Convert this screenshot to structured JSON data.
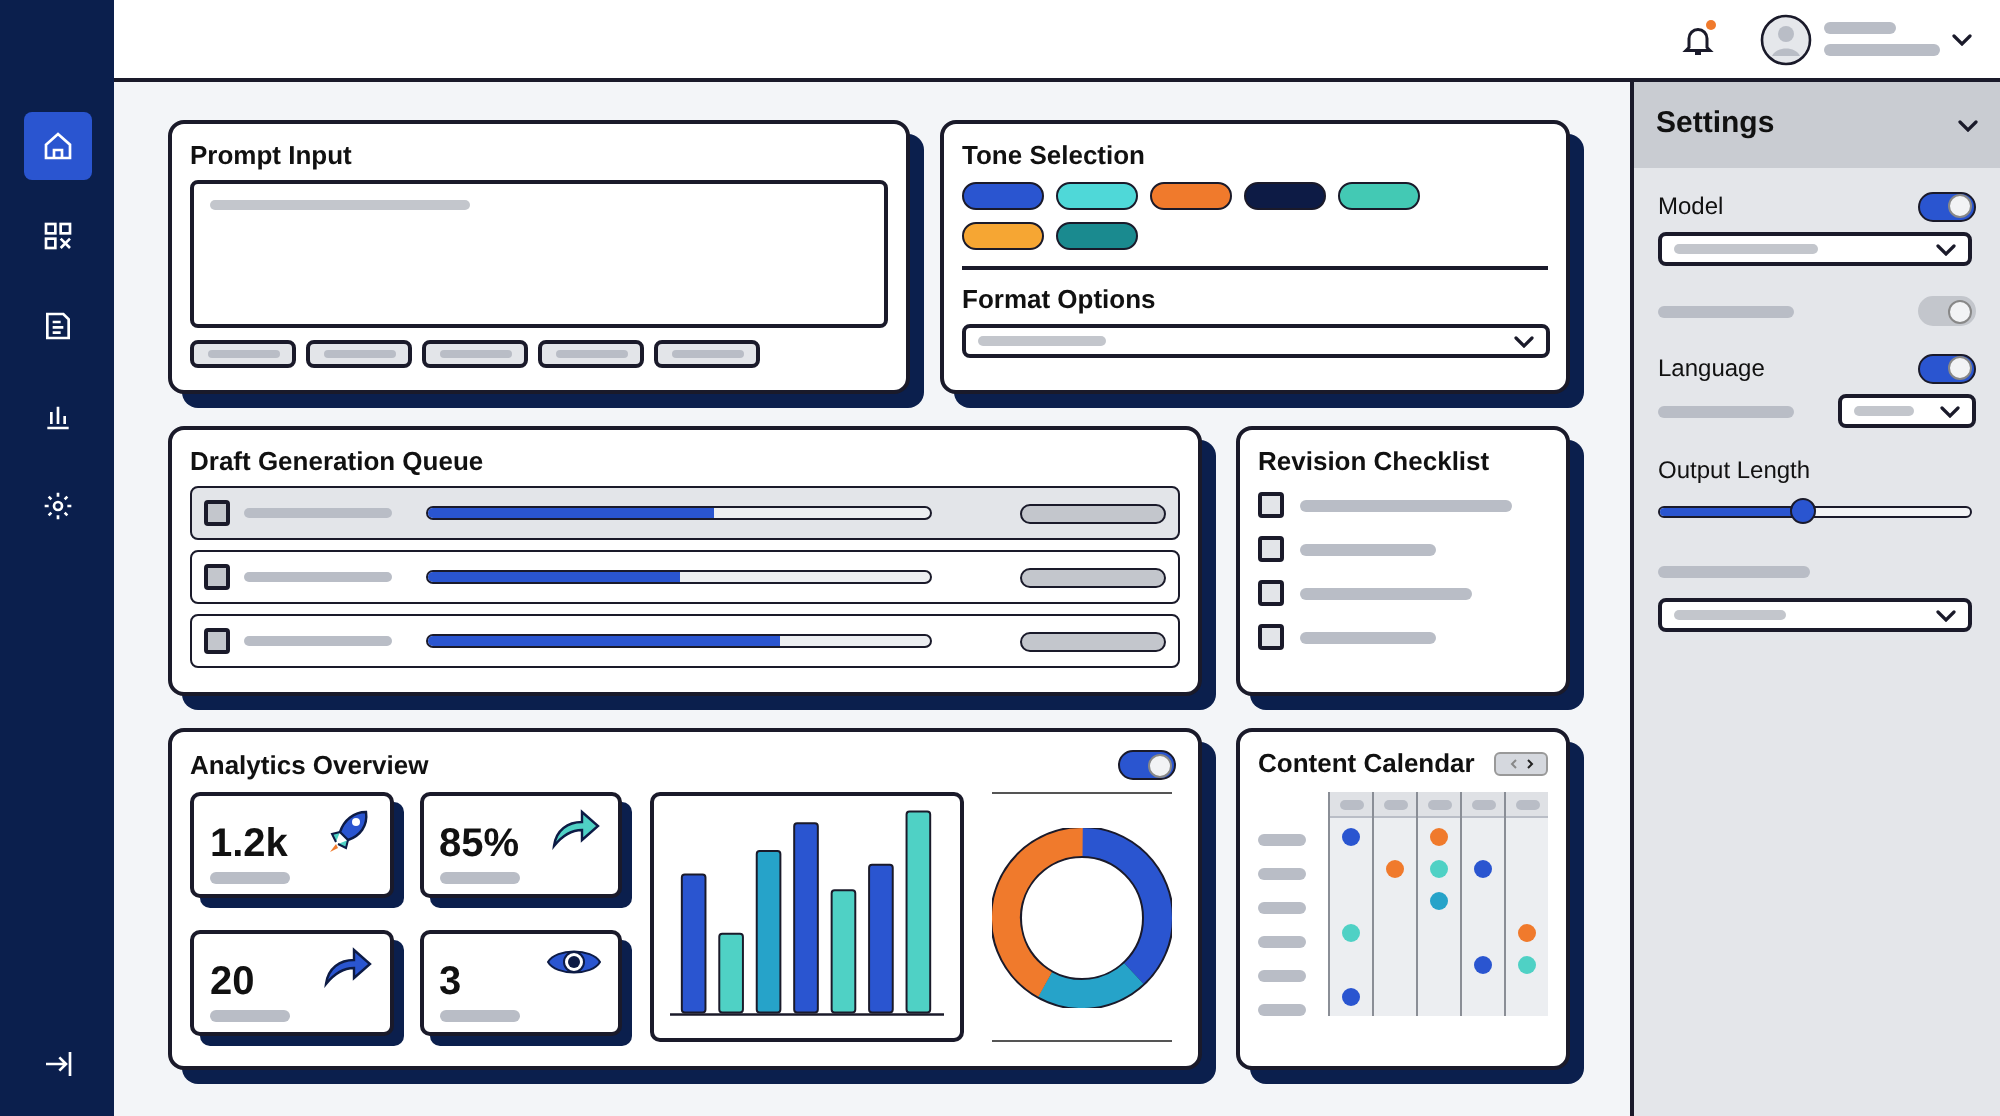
{
  "sidebar": {
    "nav_items": [
      {
        "selected": true
      },
      {
        "selected": false
      },
      {
        "selected": false
      },
      {
        "selected": false
      },
      {
        "selected": false
      }
    ]
  },
  "header": {
    "notification_dot": true
  },
  "prompt_input": {
    "title": "Prompt Input"
  },
  "tone_selection": {
    "title": "Tone Selection",
    "tones": [
      {
        "color": "#2a55d0"
      },
      {
        "color": "#4fd8d8"
      },
      {
        "color": "#f07a2c"
      },
      {
        "color": "#0d1b45"
      },
      {
        "color": "#43c9b4"
      },
      {
        "color": "#f6a633"
      },
      {
        "color": "#1a8a8f"
      }
    ]
  },
  "format_options": {
    "title": "Format Options"
  },
  "draft_queue": {
    "title": "Draft Generation Queue",
    "rows": [
      {
        "selected": true,
        "checked": false,
        "level": 0.57
      },
      {
        "selected": false,
        "checked": false,
        "level": 0.5
      },
      {
        "selected": false,
        "checked": false,
        "level": 0.7
      }
    ]
  },
  "revision_checklist": {
    "title": "Revision Checklist",
    "items": [
      {
        "checked": false
      },
      {
        "checked": false
      },
      {
        "checked": false
      },
      {
        "checked": false
      }
    ]
  },
  "analytics": {
    "title": "Analytics Overview",
    "toggle_on": true,
    "stats": [
      {
        "value": "1.2k",
        "kind": "rocket"
      },
      {
        "value": "85%",
        "kind": "trend"
      },
      {
        "value": "20",
        "kind": "share"
      },
      {
        "value": "3",
        "kind": "eye"
      }
    ]
  },
  "content_calendar": {
    "title": "Content Calendar",
    "rows": [
      {
        "cells": [
          {
            "color": "#2a55d0"
          },
          null,
          {
            "color": "#f07a2c"
          },
          null,
          null
        ]
      },
      {
        "cells": [
          null,
          {
            "color": "#f07a2c"
          },
          {
            "color": "#4fd1c5"
          },
          {
            "color": "#2a55d0"
          },
          null
        ]
      },
      {
        "cells": [
          null,
          null,
          {
            "color": "#26a3c9"
          },
          null,
          null
        ]
      },
      {
        "cells": [
          {
            "color": "#4fd1c5"
          },
          null,
          null,
          null,
          {
            "color": "#f07a2c"
          }
        ]
      },
      {
        "cells": [
          null,
          null,
          null,
          {
            "color": "#2a55d0"
          },
          {
            "color": "#4fd1c5"
          }
        ]
      },
      {
        "cells": [
          {
            "color": "#2a55d0"
          },
          null,
          null,
          null,
          null
        ]
      }
    ]
  },
  "settings": {
    "title": "Settings",
    "model_label": "Model",
    "model_on": true,
    "second_toggle": {
      "on": true,
      "disabled": true
    },
    "language_label": "Language",
    "language_on": true,
    "output_length_label": "Output Length",
    "output_length": {
      "level": 0.46
    }
  }
}
